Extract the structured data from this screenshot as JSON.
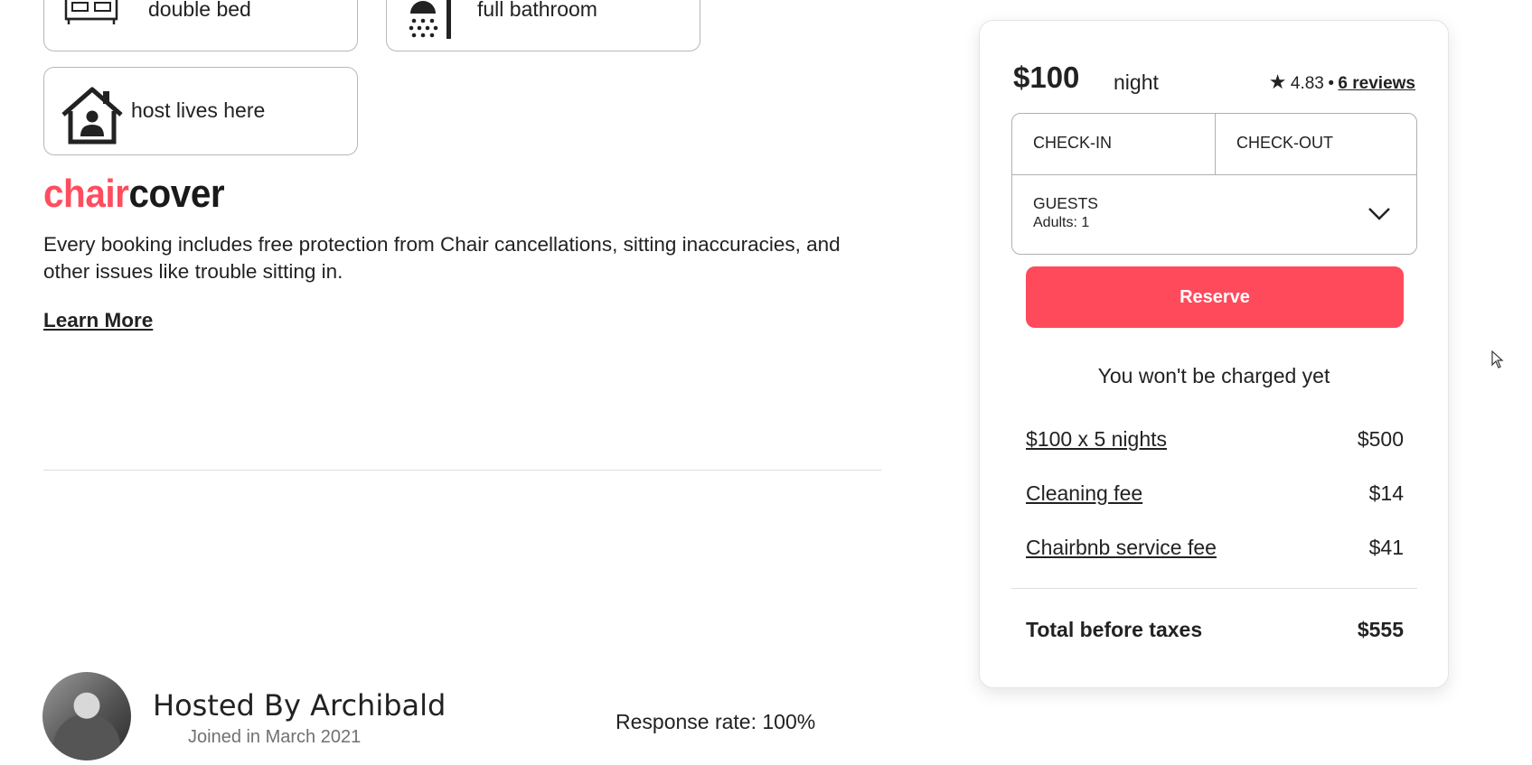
{
  "amenities": [
    {
      "label": "double bed",
      "icon": "bed-icon"
    },
    {
      "label": "full bathroom",
      "icon": "shower-icon"
    },
    {
      "label": "host lives here",
      "icon": "house-host-icon"
    }
  ],
  "aircover": {
    "logo_part1": "chair",
    "logo_part2": "cover",
    "description": "Every booking includes free protection from Chair cancellations, sitting inaccuracies, and other issues like trouble sitting in.",
    "learn_more": "Learn More"
  },
  "host": {
    "title": "Hosted By Archibald",
    "joined": "Joined in March 2021",
    "response_rate": "Response rate: 100%"
  },
  "booking": {
    "price": "$100",
    "per": "night",
    "rating": "4.83",
    "separator": "•",
    "reviews": "6 reviews",
    "checkin_label": "CHECK-IN",
    "checkout_label": "CHECK-OUT",
    "guests_label": "GUESTS",
    "guests_value": "Adults: 1",
    "reserve_label": "Reserve",
    "notice": "You won't be charged yet",
    "fees": [
      {
        "label": "$100 x 5 nights",
        "amount": "$500"
      },
      {
        "label": "Cleaning fee",
        "amount": "$14"
      },
      {
        "label": "Chairbnb service fee",
        "amount": "$41"
      }
    ],
    "total_label": "Total before taxes",
    "total_amount": "$555"
  },
  "colors": {
    "brand": "#ff4a5c",
    "text": "#222222",
    "muted": "#717171"
  }
}
